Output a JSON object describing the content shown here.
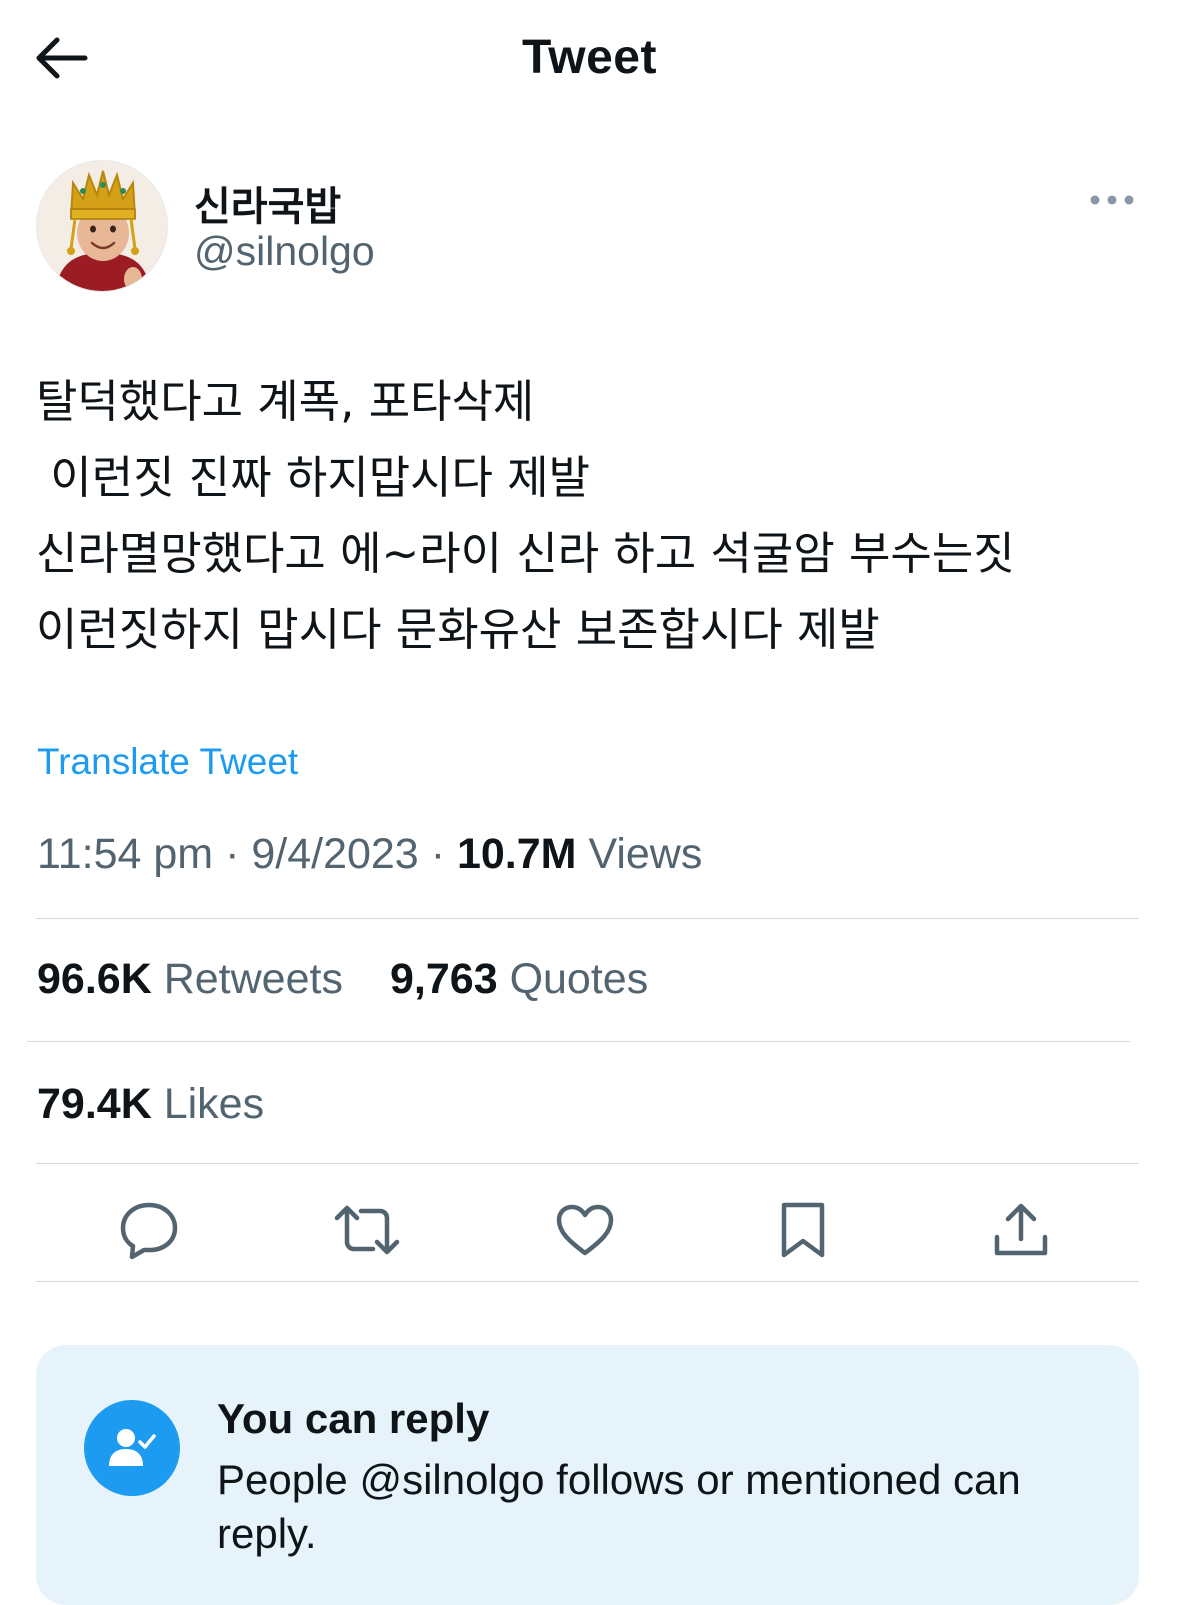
{
  "header": {
    "title": "Tweet",
    "back_icon": "arrow-left-icon"
  },
  "author": {
    "display_name": "신라국밥",
    "handle": "@silnolgo",
    "more_icon": "more-horizontal-icon"
  },
  "tweet": {
    "lines": [
      "탈덕했다고 계폭, 포타삭제",
      " 이런짓 진짜 하지맙시다 제발",
      "신라멸망했다고 에~라이 신라 하고 석굴암 부수는짓",
      "이런짓하지 맙시다 문화유산 보존합시다 제발"
    ],
    "translate_label": "Translate Tweet"
  },
  "meta": {
    "time": "11:54 pm",
    "date": "9/4/2023",
    "views_count": "10.7M",
    "views_label": "Views",
    "separator": "·"
  },
  "stats": {
    "retweets_count": "96.6K",
    "retweets_label": "Retweets",
    "quotes_count": "9,763",
    "quotes_label": "Quotes",
    "likes_count": "79.4K",
    "likes_label": "Likes"
  },
  "actions": [
    {
      "name": "reply",
      "icon": "comment-icon"
    },
    {
      "name": "retweet",
      "icon": "retweet-icon"
    },
    {
      "name": "like",
      "icon": "heart-icon"
    },
    {
      "name": "bookmark",
      "icon": "bookmark-icon"
    },
    {
      "name": "share",
      "icon": "share-icon"
    }
  ],
  "reply_card": {
    "title": "You can reply",
    "description": "People @silnolgo follows or mentioned can reply.",
    "icon": "person-check-icon"
  },
  "colors": {
    "accent": "#1d9bf0",
    "secondary_text": "#536471",
    "primary_text": "#0f1419",
    "reply_card_bg": "#e7f3fb"
  }
}
